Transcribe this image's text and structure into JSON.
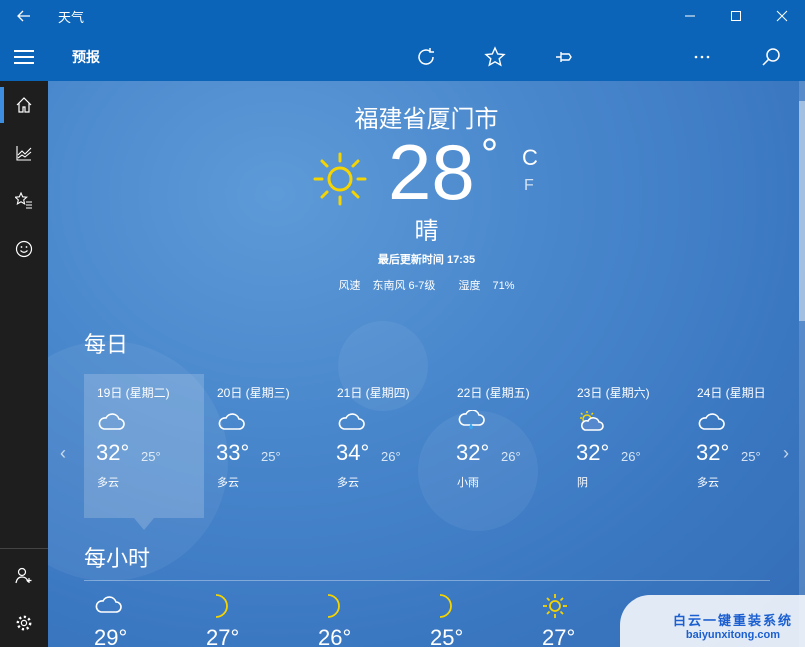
{
  "window": {
    "title": "天气",
    "back_icon": "back-arrow-icon"
  },
  "appbar": {
    "title": "预报",
    "actions": [
      "refresh-icon",
      "star-icon",
      "pin-icon",
      "moon-icon",
      "more-icon",
      "search-icon"
    ]
  },
  "sidebar": {
    "items": [
      "home-icon",
      "chart-icon",
      "favorites-icon",
      "smiley-icon"
    ],
    "bottom_items": [
      "add-user-icon",
      "settings-icon"
    ]
  },
  "current": {
    "city": "福建省厦门市",
    "temperature": "28",
    "degree": "°",
    "unit_c": "C",
    "unit_f": "F",
    "condition": "晴",
    "updated": "最后更新时间 17:35",
    "wind_label": "风速",
    "wind_value": "东南风 6-7级",
    "humidity_label": "湿度",
    "humidity_value": "71%"
  },
  "daily": {
    "title": "每日",
    "days": [
      {
        "date": "19日 (星期二)",
        "high": "32°",
        "low": "25°",
        "condition": "多云",
        "icon": "cloudy-icon"
      },
      {
        "date": "20日 (星期三)",
        "high": "33°",
        "low": "25°",
        "condition": "多云",
        "icon": "cloudy-icon"
      },
      {
        "date": "21日 (星期四)",
        "high": "34°",
        "low": "26°",
        "condition": "多云",
        "icon": "cloudy-icon"
      },
      {
        "date": "22日 (星期五)",
        "high": "32°",
        "low": "26°",
        "condition": "小雨",
        "icon": "light-rain-icon"
      },
      {
        "date": "23日 (星期六)",
        "high": "32°",
        "low": "26°",
        "condition": "阴",
        "icon": "overcast-icon"
      },
      {
        "date": "24日 (星期日",
        "high": "32°",
        "low": "25°",
        "condition": "多云",
        "icon": "cloudy-icon"
      }
    ]
  },
  "hourly": {
    "title": "每小时",
    "hours": [
      {
        "temp": "29°",
        "icon": "cloudy-icon"
      },
      {
        "temp": "27°",
        "icon": "moon-icon"
      },
      {
        "temp": "26°",
        "icon": "moon-icon"
      },
      {
        "temp": "25°",
        "icon": "moon-icon"
      },
      {
        "temp": "27°",
        "icon": "sun-icon"
      }
    ]
  },
  "watermark": {
    "line1": "白云一键重装系统",
    "line2": "baiyunxitong.com"
  },
  "colors": {
    "titlebar": "#0c64b8",
    "sidebar": "#1e1e1e",
    "sun": "#f5d400",
    "accent": "#3d8de0"
  }
}
